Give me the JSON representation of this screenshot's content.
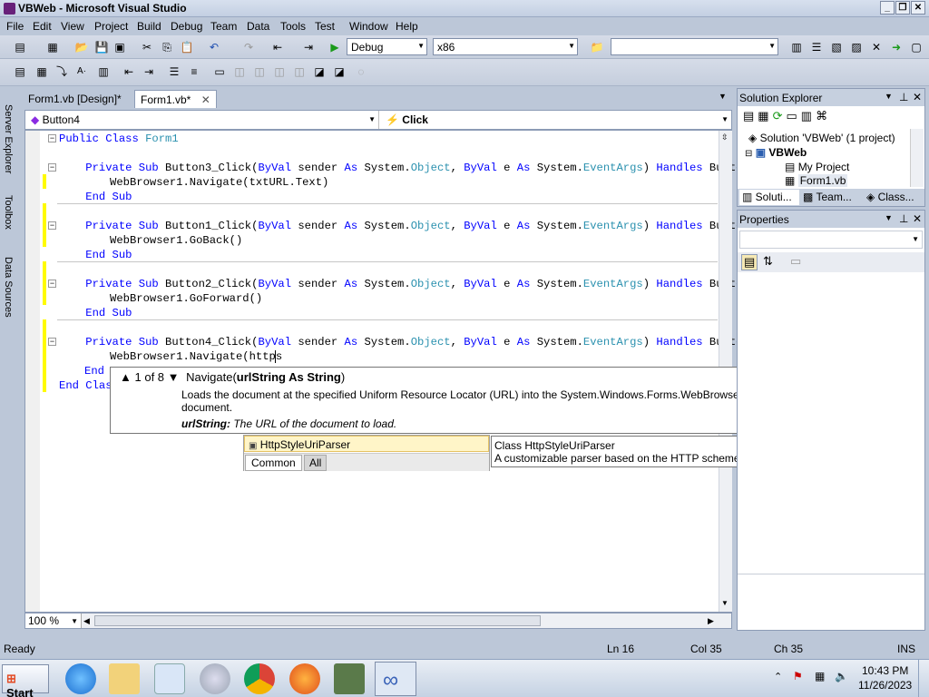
{
  "window": {
    "title": "VBWeb - Microsoft Visual Studio"
  },
  "menu": [
    "File",
    "Edit",
    "View",
    "Project",
    "Build",
    "Debug",
    "Team",
    "Data",
    "Tools",
    "Test",
    "Window",
    "Help"
  ],
  "toolbar": {
    "config": "Debug",
    "platform": "x86",
    "find_value": ""
  },
  "side_tabs": [
    "Server Explorer",
    "Toolbox",
    "Data Sources"
  ],
  "doc_tabs": [
    {
      "label": "Form1.vb [Design]*"
    },
    {
      "label": "Form1.vb*"
    }
  ],
  "navbar": {
    "object": "Button4",
    "member": "Click"
  },
  "code": {
    "line1": "Public Class Form1",
    "b3_sig": "Private Sub Button3_Click(ByVal sender As System.Object, ByVal e As System.EventArgs) Handles Button",
    "b3_body": "WebBrowser1.Navigate(txtURL.Text)",
    "end_sub": "End Sub",
    "b1_sig": "Private Sub Button1_Click(ByVal sender As System.Object, ByVal e As System.EventArgs) Handles Button",
    "b1_body": "WebBrowser1.GoBack()",
    "b2_sig": "Private Sub Button2_Click(ByVal sender As System.Object, ByVal e As System.EventArgs) Handles Button",
    "b2_body": "WebBrowser1.GoForward()",
    "b4_sig": "Private Sub Button4_Click(ByVal sender As System.Object, ByVal e As System.EventArgs) Handles Button",
    "b4_body": "WebBrowser1.Navigate(https",
    "end_sub_partial": "End",
    "end_class_partial": "End Clas"
  },
  "param_info": {
    "counter": "1 of 8",
    "method": "Navigate(",
    "param": "urlString As String",
    "close": ")",
    "description": "Loads the document at the specified Uniform Resource Locator (URL) into the System.Windows.Forms.WebBrowser control, replacing the previous document.",
    "param_name": "urlString:",
    "param_desc": "The URL of the document to load."
  },
  "intellisense": {
    "item": "HttpStyleUriParser",
    "tabs": [
      "Common",
      "All"
    ]
  },
  "tooltip": {
    "line1": "Class HttpStyleUriParser",
    "line2": "A customizable parser based on the HTTP scheme."
  },
  "zoom": "100 %",
  "solution_explorer": {
    "title": "Solution Explorer",
    "solution": "Solution 'VBWeb' (1 project)",
    "project": "VBWeb",
    "my_project": "My Project",
    "file": "Form1.vb",
    "tabs": [
      "Soluti...",
      "Team...",
      "Class..."
    ]
  },
  "properties": {
    "title": "Properties"
  },
  "status": {
    "ready": "Ready",
    "ln": "Ln 16",
    "col": "Col 35",
    "ch": "Ch 35",
    "mode": "INS"
  },
  "taskbar": {
    "start": "Start",
    "time": "10:43 PM",
    "date": "11/26/2023"
  }
}
